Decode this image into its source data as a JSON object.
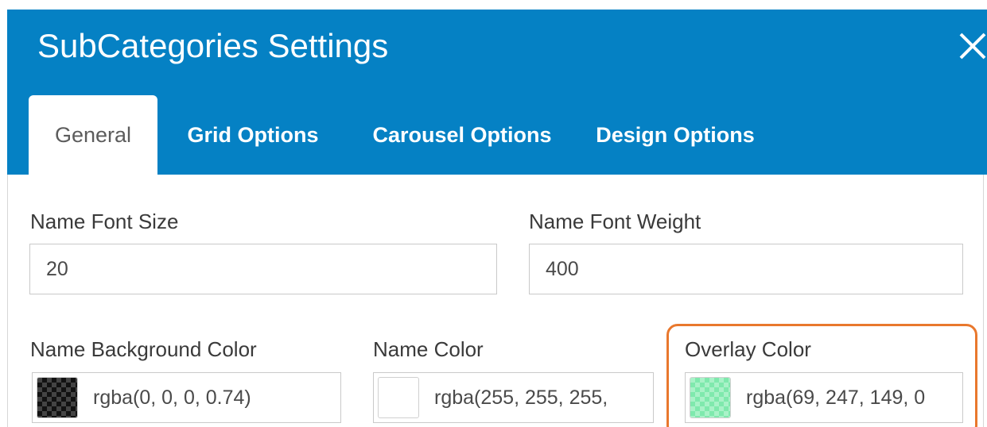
{
  "dialog": {
    "title": "SubCategories Settings"
  },
  "tabs": [
    {
      "label": "General",
      "active": true
    },
    {
      "label": "Grid Options",
      "active": false
    },
    {
      "label": "Carousel Options",
      "active": false
    },
    {
      "label": "Design Options",
      "active": false
    }
  ],
  "fields": {
    "name_font_size": {
      "label": "Name Font Size",
      "value": "20"
    },
    "name_font_weight": {
      "label": "Name Font Weight",
      "value": "400"
    },
    "name_background_color": {
      "label": "Name Background Color",
      "value": "rgba(0, 0, 0, 0.74)"
    },
    "name_color": {
      "label": "Name Color",
      "value": "rgba(255, 255, 255,"
    },
    "overlay_color": {
      "label": "Overlay Color",
      "value": "rgba(69, 247, 149, 0"
    }
  },
  "colors": {
    "header_bg": "#0581c4",
    "highlight": "#e9782d"
  },
  "icons": {
    "close": "close-icon"
  }
}
